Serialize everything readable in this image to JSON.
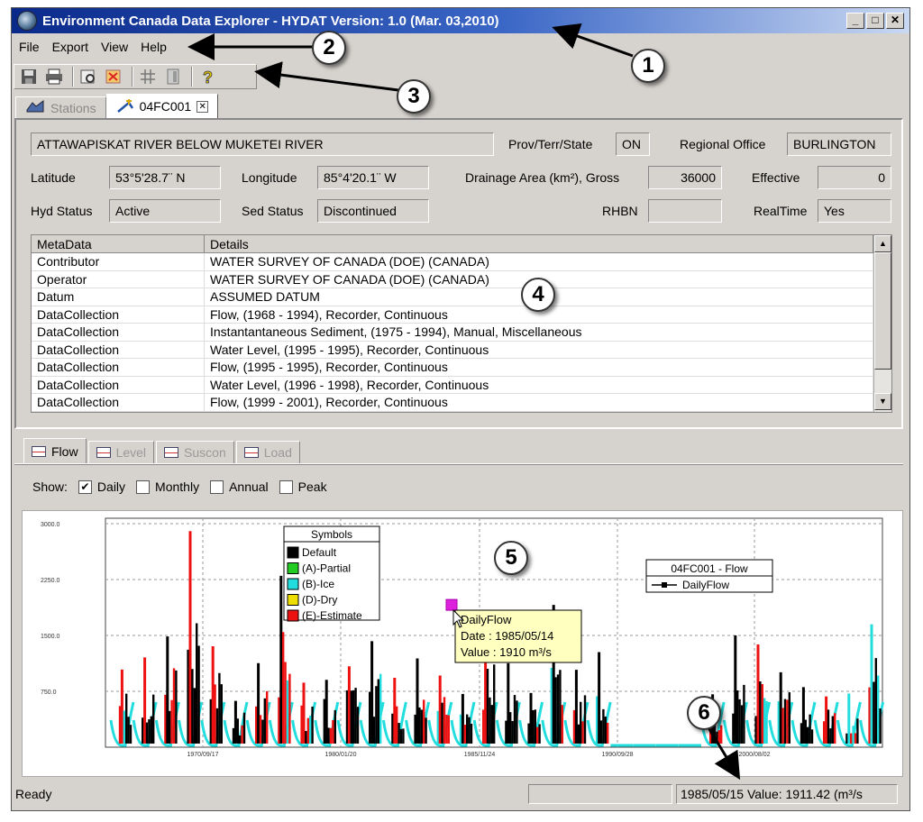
{
  "window": {
    "title": "Environment Canada Data Explorer  - HYDAT Version: 1.0 (Mar. 03,2010)",
    "min_label": "_",
    "max_label": "□",
    "close_label": "✕"
  },
  "menu": [
    {
      "label": "File"
    },
    {
      "label": "Export"
    },
    {
      "label": "View"
    },
    {
      "label": "Help"
    }
  ],
  "toolbar_icons": [
    "save-icon",
    "print-icon",
    "print-preview-icon",
    "close-icon",
    "grid-icon",
    "panel-icon",
    "help-icon"
  ],
  "doc_tabs": [
    {
      "label": "Stations",
      "active": false
    },
    {
      "label": "04FC001",
      "active": true,
      "close": "✕"
    }
  ],
  "station": {
    "name": "ATTAWAPISKAT RIVER BELOW MUKETEI RIVER",
    "prov_label": "Prov/Terr/State",
    "prov": "ON",
    "office_label": "Regional Office",
    "office": "BURLINGTON",
    "lat_label": "Latitude",
    "lat": "53°5'28.7¨ N",
    "lon_label": "Longitude",
    "lon": "85°4'20.1¨ W",
    "drainage_label": "Drainage Area (km²),  Gross",
    "gross": "36000",
    "effective_label": "Effective",
    "effective": "0",
    "hyd_label": "Hyd Status",
    "hyd": "Active",
    "sed_label": "Sed Status",
    "sed": "Discontinued",
    "rhbn_label": "RHBN",
    "rhbn": "",
    "realtime_label": "RealTime",
    "realtime": "Yes"
  },
  "metadata": {
    "headers": [
      "MetaData",
      "Details"
    ],
    "rows": [
      [
        "Contributor",
        "WATER SURVEY OF CANADA (DOE) (CANADA)"
      ],
      [
        "Operator",
        "WATER SURVEY OF CANADA (DOE) (CANADA)"
      ],
      [
        "Datum",
        "ASSUMED DATUM"
      ],
      [
        "DataCollection",
        "Flow, (1968 - 1994), Recorder, Continuous"
      ],
      [
        "DataCollection",
        "Instantantaneous Sediment, (1975 - 1994), Manual, Miscellaneous"
      ],
      [
        "DataCollection",
        "Water Level, (1995 - 1995), Recorder, Continuous"
      ],
      [
        "DataCollection",
        "Flow, (1995 - 1995), Recorder, Continuous"
      ],
      [
        "DataCollection",
        "Water Level, (1996 - 1998), Recorder, Continuous"
      ],
      [
        "DataCollection",
        "Flow, (1999 - 2001), Recorder, Continuous"
      ]
    ]
  },
  "chart_tabs": [
    {
      "label": "Flow",
      "active": true
    },
    {
      "label": "Level",
      "active": false
    },
    {
      "label": "Suscon",
      "active": false
    },
    {
      "label": "Load",
      "active": false
    }
  ],
  "show": {
    "label": "Show:",
    "options": [
      {
        "label": "Daily",
        "checked": true
      },
      {
        "label": "Monthly",
        "checked": false
      },
      {
        "label": "Annual",
        "checked": false
      },
      {
        "label": "Peak",
        "checked": false
      }
    ]
  },
  "legend_symbols": {
    "title": "Symbols",
    "items": [
      {
        "label": "Default",
        "color": "#000000"
      },
      {
        "label": "(A)-Partial",
        "color": "#22cc22"
      },
      {
        "label": "(B)-Ice",
        "color": "#22dddd"
      },
      {
        "label": "(D)-Dry",
        "color": "#eedd00"
      },
      {
        "label": "(E)-Estimate",
        "color": "#ee1111"
      }
    ]
  },
  "legend_series": {
    "title": "04FC001 - Flow",
    "item": "DailyFlow"
  },
  "tooltip": {
    "title": "DailyFlow",
    "date": "Date : 1985/05/14",
    "value": "Value : 1910 m³/s"
  },
  "status": {
    "ready": "Ready",
    "middle": "",
    "readout": "1985/05/15  Value: 1911.42 (m³/s"
  },
  "callouts": [
    "1",
    "2",
    "3",
    "4",
    "5",
    "6"
  ],
  "chart_data": {
    "type": "line",
    "title": "",
    "xlabel": "",
    "ylabel": "",
    "y_ticks": [
      "3000.0",
      "2250.0",
      "1500.0",
      "750.0"
    ],
    "x_ticks": [
      "1970/09/17",
      "1980/01/20",
      "1985/11/24",
      "1990/09/28",
      "2000/08/02"
    ],
    "series": [
      {
        "name": "DailyFlow"
      }
    ],
    "highlight_point": {
      "date": "1985/05/14",
      "value": 1910
    },
    "colors": {
      "default": "#000000",
      "partial": "#22cc22",
      "ice": "#22dddd",
      "dry": "#eedd00",
      "estimate": "#ee1111",
      "highlight": "#dd22dd"
    }
  }
}
